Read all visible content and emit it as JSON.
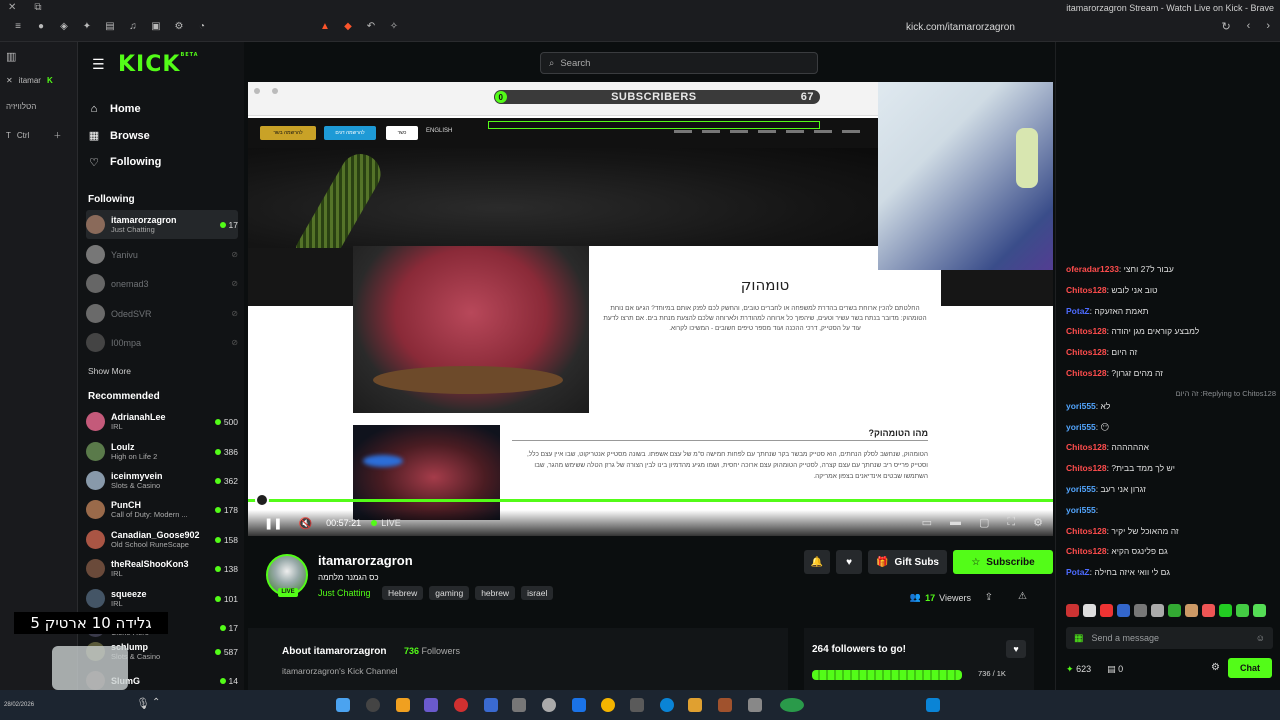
{
  "browser": {
    "window_title": "itamarorzagron Stream - Watch Live on Kick - Brave",
    "url": "kick.com/itamarorzagron",
    "rail_items": [
      "itamar",
      "הטלוויזיה",
      "Ctrl"
    ]
  },
  "search": {
    "placeholder": "Search"
  },
  "sidebar": {
    "nav": [
      {
        "label": "Home",
        "icon": "home-icon"
      },
      {
        "label": "Browse",
        "icon": "browse-icon"
      },
      {
        "label": "Following",
        "icon": "heart-icon"
      }
    ],
    "following_header": "Following",
    "following": [
      {
        "name": "itamarorzagron",
        "category": "Just Chatting",
        "viewers": "17",
        "live": true
      },
      {
        "name": "Yanivu",
        "category": "",
        "viewers": "",
        "live": false
      },
      {
        "name": "onemad3",
        "category": "",
        "viewers": "",
        "live": false
      },
      {
        "name": "OdedSVR",
        "category": "",
        "viewers": "",
        "live": false
      },
      {
        "name": "I00mpa",
        "category": "",
        "viewers": "",
        "live": false
      }
    ],
    "show_more": "Show More",
    "recommended_header": "Recommended",
    "recommended": [
      {
        "name": "AdrianahLee",
        "category": "IRL",
        "viewers": "500"
      },
      {
        "name": "Loulz",
        "category": "High on Life 2",
        "viewers": "386"
      },
      {
        "name": "iceinmyvein",
        "category": "Slots & Casino",
        "viewers": "362"
      },
      {
        "name": "PunCH",
        "category": "Call of Duty: Modern ...",
        "viewers": "178"
      },
      {
        "name": "Canadian_Goose902",
        "category": "Old School RuneScape",
        "viewers": "158"
      },
      {
        "name": "theRealShooKon3",
        "category": "IRL",
        "viewers": "138"
      },
      {
        "name": "squeeze",
        "category": "IRL",
        "viewers": "101"
      },
      {
        "name": "...son",
        "category": "Clone Hero",
        "viewers": "17"
      },
      {
        "name": "schlump",
        "category": "Slots & Casino",
        "viewers": "587"
      },
      {
        "name": "SlumG",
        "category": "",
        "viewers": "14"
      }
    ]
  },
  "overlay_text": "גלידה 10 ארטיק 5",
  "video": {
    "subscribers_label": "SUBSCRIBERS",
    "subscribers_left": "0",
    "subscribers_count": "67",
    "site_buttons": [
      "להרשמה בשר",
      "להרשמה דגים",
      "כשר",
      "ENGLISH"
    ],
    "article_title": "טומהוק",
    "article_body": "החלטתם להכין ארוחת בשרים בהדרת למשפחה או לחברים טובים, והחשק לכם לפנק אותם במיוחד? הגיעו אם נוחת הטומהוק: מדובר בנתח בשר עשיר וטעים, שיהפוך כל ארוחה למהודרת ולארוחה שלכם להצעת מנחת בים. אם תרצו לדעת עוד על הסטייק, דרכי ההכנה ועוד מספר טיפים חשובים - המשיכו לקרוא.",
    "section_title": "מהו הטומהוק?",
    "section_body": "הטומהוק, שנחשב לסלק הנחתים, הוא סטייק מבשר בקר שנחתך עם לפחות חמישה ס\"מ של עצם אשפתו. בשונה מסטייק אנטריקוט, שבו איין עצם כלל, וסטייק פרייס ריב שנחתך עם עצם קצרה, לסטייק הטומהוק עצם ארוכה יחסית, ושמו מגיע מהדמיון בינו לבין הצורה של גרזן הטלה ששימש מהגר, שבו השתמשו שבטים אינדיאנים בצפון אמריקה.",
    "elapsed": "00:57:21",
    "live_label": "LIVE"
  },
  "stream": {
    "channel": "itamarorzagron",
    "title": "כס הגמנר מלחמה",
    "category": "Just Chatting",
    "tags": [
      "Hebrew",
      "gaming",
      "hebrew",
      "israel"
    ],
    "gift_subs": "Gift Subs",
    "subscribe": "Subscribe",
    "viewers": "17",
    "viewers_label": "Viewers",
    "live_badge": "LIVE"
  },
  "about": {
    "title": "About itamarorzagron",
    "followers_count": "736",
    "followers_label": "Followers",
    "description": "itamarorzagron's Kick Channel"
  },
  "goal": {
    "title": "264 followers to go!",
    "progress_text": "736 / 1K",
    "progress_fraction": 0.736
  },
  "chat": {
    "messages": [
      {
        "user": "oferadar1233",
        "text": "עבור ל27 וחצי",
        "color": "#ff4d4d"
      },
      {
        "user": "Chitos128",
        "text": "טוב אני לובש",
        "color": "#ff4d4d"
      },
      {
        "user": "PotaZ",
        "text": "תאמת האזעקה",
        "color": "#4d6bff"
      },
      {
        "user": "Chitos128",
        "text": "למבצע קוראים מגן יהודה",
        "color": "#ff4d4d"
      },
      {
        "user": "Chitos128",
        "text": "זה היום",
        "color": "#ff4d4d"
      },
      {
        "user": "Chitos128",
        "text": "זה מהים זגרון?",
        "color": "#ff4d4d"
      },
      {
        "reply": "Replying to Chitos128: זה היום"
      },
      {
        "user": "yori555",
        "text": "לא",
        "color": "#53a6ff"
      },
      {
        "user": "yori555",
        "text": "😶",
        "color": "#53a6ff"
      },
      {
        "user": "Chitos128",
        "text": "אהההההה",
        "color": "#ff4d4d"
      },
      {
        "user": "Chitos128",
        "text": "יש לך ממד בבית?",
        "color": "#ff4d4d"
      },
      {
        "user": "yori555",
        "text": "זגרון אני רעב",
        "color": "#53a6ff"
      },
      {
        "user": "yori555",
        "text": "",
        "color": "#53a6ff"
      },
      {
        "user": "Chitos128",
        "text": "זה מהאוכל של יקיר",
        "color": "#ff4d4d"
      },
      {
        "user": "Chitos128",
        "text": "גם פלינגס הקיא",
        "color": "#ff4d4d"
      },
      {
        "user": "PotaZ",
        "text": "גם לי וואי איזה בחילה",
        "color": "#4d6bff"
      }
    ],
    "send_placeholder": "Send a message",
    "points": "623",
    "other_count": "0",
    "chat_button": "Chat"
  },
  "taskbar": {
    "date": "28/02/2026"
  }
}
